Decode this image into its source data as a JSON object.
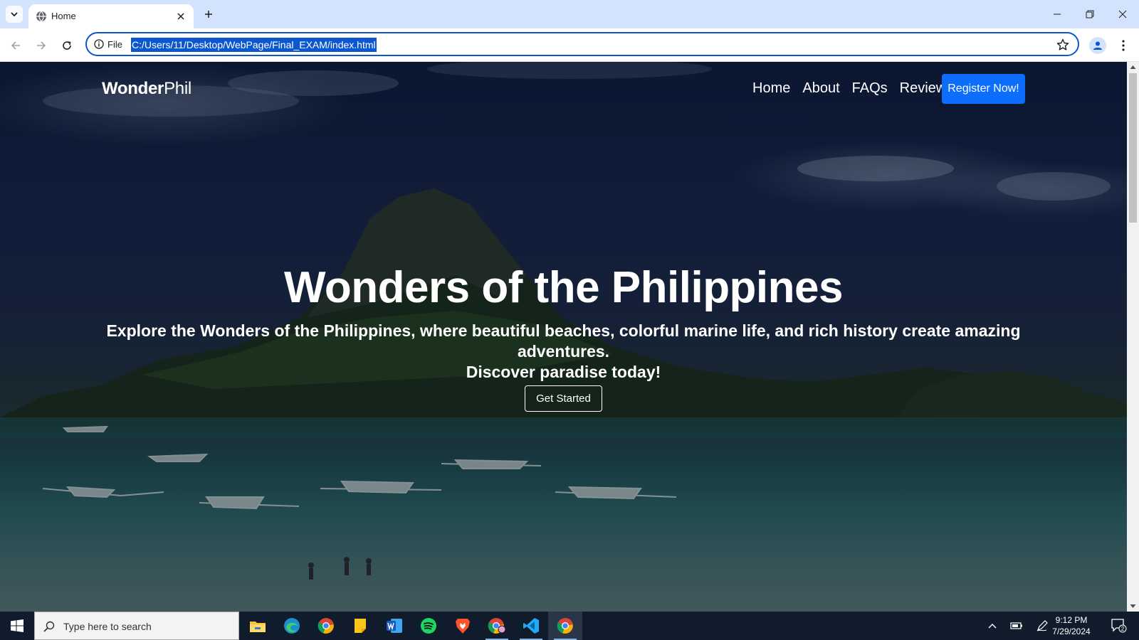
{
  "browser": {
    "tab_title": "Home",
    "omnibox_scheme": "File",
    "url": "C:/Users/11/Desktop/WebPage/Final_EXAM/index.html"
  },
  "site": {
    "brand_bold": "Wonder",
    "brand_light": "Phil",
    "nav": [
      "Home",
      "About",
      "FAQs",
      "Review"
    ],
    "register_label": "Register Now!",
    "hero_title": "Wonders of the Philippines",
    "hero_subtitle_line1": "Explore the Wonders of the Philippines, where beautiful beaches, colorful marine life, and rich history create amazing adventures.",
    "hero_subtitle_line2": "Discover paradise today!",
    "cta_label": "Get Started"
  },
  "taskbar": {
    "search_placeholder": "Type here to search",
    "time": "9:12 PM",
    "date": "7/29/2024",
    "notification_count": "2",
    "apps": [
      "file-explorer-icon",
      "edge-icon",
      "chrome-icon",
      "sticky-notes-icon",
      "word-icon",
      "spotify-icon",
      "brave-icon",
      "chrome-profile-icon",
      "vscode-icon",
      "chrome-active-icon"
    ]
  },
  "colors": {
    "accent": "#0d6efd",
    "omnibox_border": "#0b57d0",
    "tabbar": "#d3e3fd",
    "taskbar": "#101b2b"
  }
}
